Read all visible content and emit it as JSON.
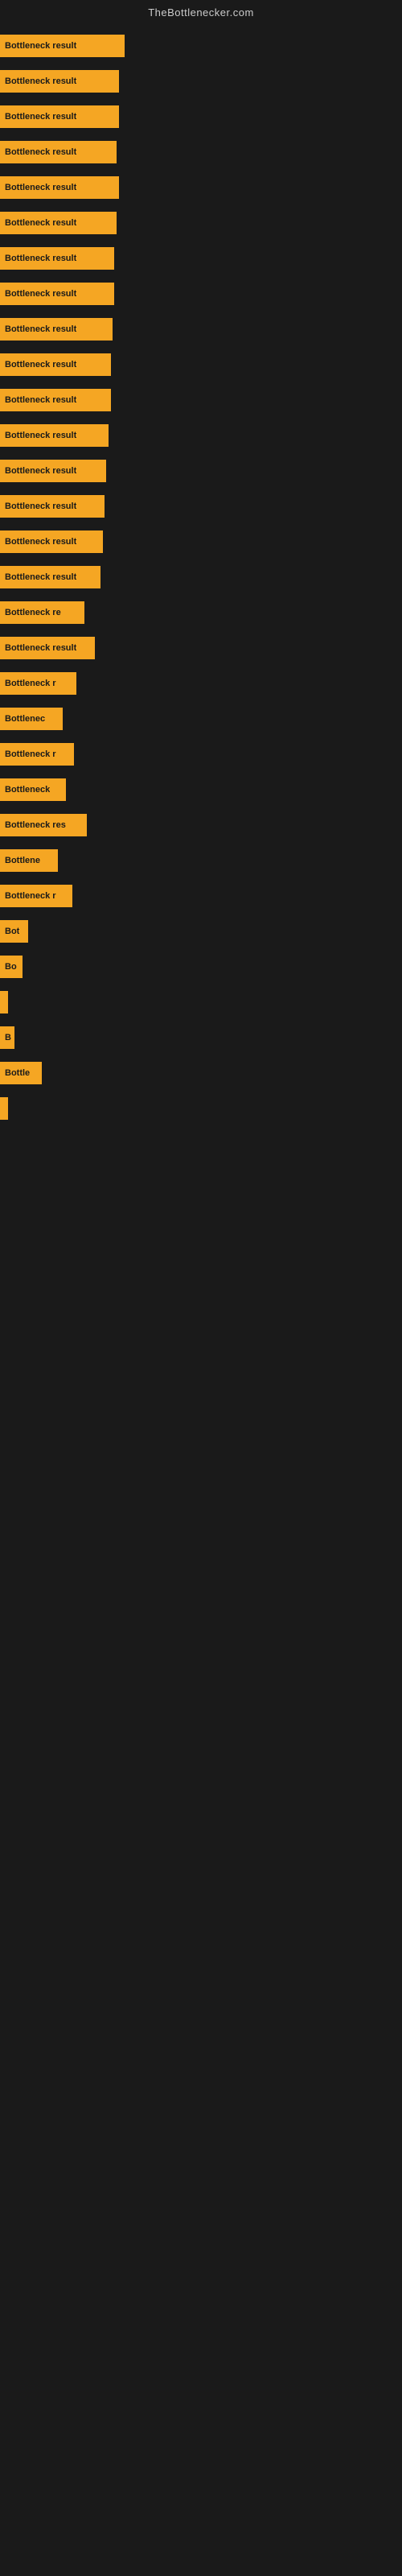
{
  "header": {
    "title": "TheBottlenecker.com"
  },
  "bars": [
    {
      "label": "Bottleneck result",
      "width": 155
    },
    {
      "label": "Bottleneck result",
      "width": 148
    },
    {
      "label": "Bottleneck result",
      "width": 148
    },
    {
      "label": "Bottleneck result",
      "width": 145
    },
    {
      "label": "Bottleneck result",
      "width": 148
    },
    {
      "label": "Bottleneck result",
      "width": 145
    },
    {
      "label": "Bottleneck result",
      "width": 142
    },
    {
      "label": "Bottleneck result",
      "width": 142
    },
    {
      "label": "Bottleneck result",
      "width": 140
    },
    {
      "label": "Bottleneck result",
      "width": 138
    },
    {
      "label": "Bottleneck result",
      "width": 138
    },
    {
      "label": "Bottleneck result",
      "width": 135
    },
    {
      "label": "Bottleneck result",
      "width": 132
    },
    {
      "label": "Bottleneck result",
      "width": 130
    },
    {
      "label": "Bottleneck result",
      "width": 128
    },
    {
      "label": "Bottleneck result",
      "width": 125
    },
    {
      "label": "Bottleneck re",
      "width": 105
    },
    {
      "label": "Bottleneck result",
      "width": 118
    },
    {
      "label": "Bottleneck r",
      "width": 95
    },
    {
      "label": "Bottlenec",
      "width": 78
    },
    {
      "label": "Bottleneck r",
      "width": 92
    },
    {
      "label": "Bottleneck",
      "width": 82
    },
    {
      "label": "Bottleneck res",
      "width": 108
    },
    {
      "label": "Bottlene",
      "width": 72
    },
    {
      "label": "Bottleneck r",
      "width": 90
    },
    {
      "label": "Bot",
      "width": 35
    },
    {
      "label": "Bo",
      "width": 28
    },
    {
      "label": "",
      "width": 8
    },
    {
      "label": "B",
      "width": 18
    },
    {
      "label": "Bottle",
      "width": 52
    },
    {
      "label": "",
      "width": 5
    }
  ]
}
